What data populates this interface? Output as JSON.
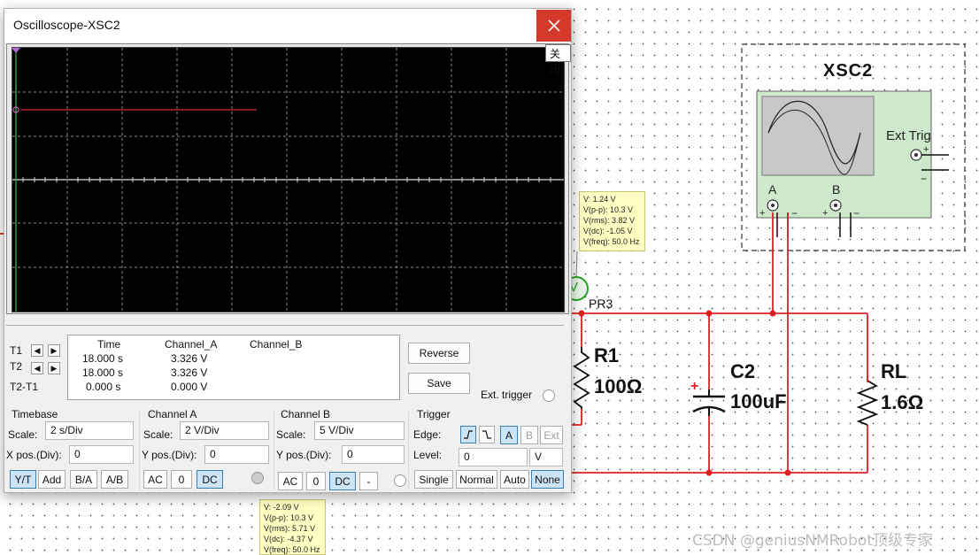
{
  "window": {
    "title": "Oscilloscope-XSC2",
    "close_tooltip": "关闭"
  },
  "cursors": {
    "t1_label": "T1",
    "t2_label": "T2",
    "diff_label": "T2-T1"
  },
  "readout": {
    "headers": [
      "Time",
      "Channel_A",
      "Channel_B"
    ],
    "rows": [
      {
        "time": "18.000 s",
        "a": "3.326 V",
        "b": ""
      },
      {
        "time": "18.000 s",
        "a": "3.326 V",
        "b": ""
      },
      {
        "time": "0.000 s",
        "a": "0.000 V",
        "b": ""
      }
    ]
  },
  "buttons": {
    "reverse": "Reverse",
    "save": "Save",
    "ext_trigger": "Ext. trigger"
  },
  "timebase": {
    "title": "Timebase",
    "scale_label": "Scale:",
    "scale_value": "2  s/Div",
    "xpos_label": "X pos.(Div):",
    "xpos_value": "0",
    "modes": [
      "Y/T",
      "Add",
      "B/A",
      "A/B"
    ],
    "active_mode": "Y/T"
  },
  "channel_a": {
    "title": "Channel A",
    "scale_label": "Scale:",
    "scale_value": "2  V/Div",
    "ypos_label": "Y pos.(Div):",
    "ypos_value": "0",
    "coupling": [
      "AC",
      "0",
      "DC"
    ],
    "active": "DC"
  },
  "channel_b": {
    "title": "Channel B",
    "scale_label": "Scale:",
    "scale_value": "5  V/Div",
    "ypos_label": "Y pos.(Div):",
    "ypos_value": "0",
    "coupling": [
      "AC",
      "0",
      "DC",
      "-"
    ],
    "active": "DC"
  },
  "trigger": {
    "title": "Trigger",
    "edge_label": "Edge:",
    "sources": [
      "A",
      "B",
      "Ext"
    ],
    "active_source": "A",
    "level_label": "Level:",
    "level_value": "0",
    "level_unit": "V",
    "modes": [
      "Single",
      "Normal",
      "Auto",
      "None"
    ],
    "active_mode": "None"
  },
  "probes": {
    "top": [
      "V: 1.24 V",
      "V(p-p): 10.3 V",
      "V(rms): 3.82 V",
      "V(dc): -1.05 V",
      "V(freq): 50.0 Hz"
    ],
    "bottom": [
      "V: -2.09 V",
      "V(p-p): 10.3 V",
      "V(rms): 5.71 V",
      "V(dc): -4.37 V",
      "V(freq): 50.0 Hz"
    ]
  },
  "schematic": {
    "instrument_name": "XSC2",
    "ext_trig": "Ext Trig",
    "channel_a": "A",
    "channel_b": "B",
    "probe_name": "PR3",
    "probe_symbol": "V",
    "r1_name": "R1",
    "r1_value": "100Ω",
    "c2_name": "C2",
    "c2_value": "100uF",
    "rl_name": "RL",
    "rl_value": "1.6Ω",
    "wire_color": "#e02020"
  },
  "watermark": "CSDN @geniusNMRobot顶级专家"
}
